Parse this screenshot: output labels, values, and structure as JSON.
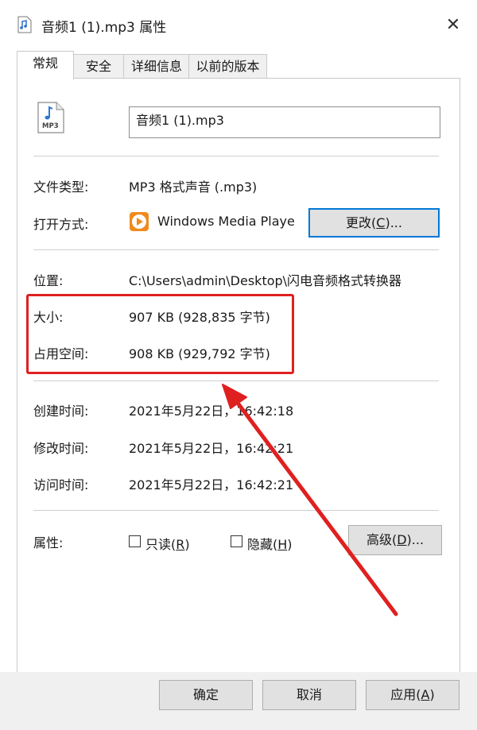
{
  "window": {
    "title": "音频1 (1).mp3 属性",
    "close_symbol": "✕"
  },
  "tabs": [
    {
      "label": "常规",
      "active": true
    },
    {
      "label": "安全",
      "active": false
    },
    {
      "label": "详细信息",
      "active": false
    },
    {
      "label": "以前的版本",
      "active": false
    }
  ],
  "file": {
    "icon": "mp3-file-icon",
    "icon_text": "MP3",
    "name": "音频1 (1).mp3"
  },
  "type": {
    "label": "文件类型:",
    "value": "MP3 格式声音 (.mp3)"
  },
  "open_with": {
    "label": "打开方式:",
    "app": "Windows Media Playe",
    "app_icon": "wmp-icon",
    "change_button": "更改(C)..."
  },
  "location": {
    "label": "位置:",
    "value": "C:\\Users\\admin\\Desktop\\闪电音频格式转换器"
  },
  "size": {
    "label": "大小:",
    "value": "907 KB (928,835 字节)"
  },
  "size_on_disk": {
    "label": "占用空间:",
    "value": "908 KB (929,792 字节)"
  },
  "created": {
    "label": "创建时间:",
    "value": "2021年5月22日，16:42:18"
  },
  "modified": {
    "label": "修改时间:",
    "value": "2021年5月22日，16:42:21"
  },
  "accessed": {
    "label": "访问时间:",
    "value": "2021年5月22日，16:42:21"
  },
  "attributes": {
    "label": "属性:",
    "readonly": {
      "label": "只读(R)",
      "checked": false
    },
    "hidden": {
      "label": "隐藏(H)",
      "checked": false
    },
    "advanced_button": "高级(D)..."
  },
  "footer": {
    "ok": "确定",
    "cancel": "取消",
    "apply": "应用(A)"
  },
  "annotation": {
    "box_color": "#e02020",
    "arrow_color": "#e02020"
  }
}
